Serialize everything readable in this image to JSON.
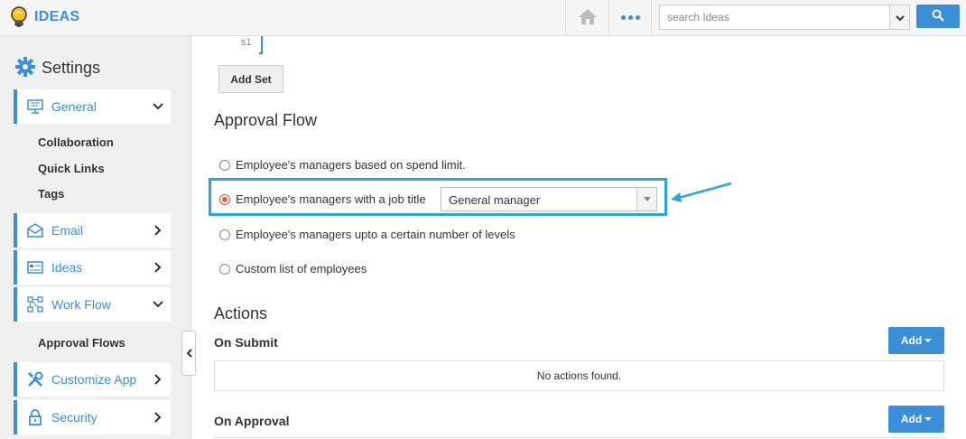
{
  "app": {
    "name": "IDEAS"
  },
  "topbar": {
    "search_placeholder": "search Ideas",
    "icons": [
      "home-icon",
      "more-dots-icon",
      "chevron-down-icon",
      "search-icon"
    ]
  },
  "sidebar": {
    "title": "Settings",
    "items": [
      {
        "label": "General",
        "icon": "monitor-icon",
        "chevron": "down"
      },
      {
        "label": "Email",
        "icon": "envelope-icon",
        "chevron": "right"
      },
      {
        "label": "Ideas",
        "icon": "ideas-icon",
        "chevron": "right"
      },
      {
        "label": "Work Flow",
        "icon": "workflow-icon",
        "chevron": "down"
      },
      {
        "label": "Customize App",
        "icon": "tools-icon",
        "chevron": "right"
      },
      {
        "label": "Security",
        "icon": "lock-icon",
        "chevron": "right"
      }
    ],
    "general_subitems": [
      "Collaboration",
      "Quick Links",
      "Tags"
    ],
    "workflow_subitems": [
      "Approval Flows"
    ]
  },
  "main": {
    "set_label": "s1",
    "add_set_label": "Add Set",
    "approval_flow": {
      "title": "Approval Flow",
      "options": [
        {
          "label": "Employee's managers based on spend limit.",
          "checked": false
        },
        {
          "label": "Employee's managers with a job title",
          "checked": true
        },
        {
          "label": "Employee's managers upto a certain number of levels",
          "checked": false
        },
        {
          "label": "Custom list of employees",
          "checked": false
        }
      ],
      "job_title_selected": "General manager"
    },
    "actions": {
      "title": "Actions",
      "on_submit": {
        "title": "On Submit",
        "add_label": "Add",
        "empty_text": "No actions found."
      },
      "on_approval": {
        "title": "On Approval",
        "add_label": "Add"
      }
    }
  },
  "colors": {
    "accent": "#3a8fd8",
    "highlight": "#27a7db",
    "radio_checked": "#e0603a"
  }
}
